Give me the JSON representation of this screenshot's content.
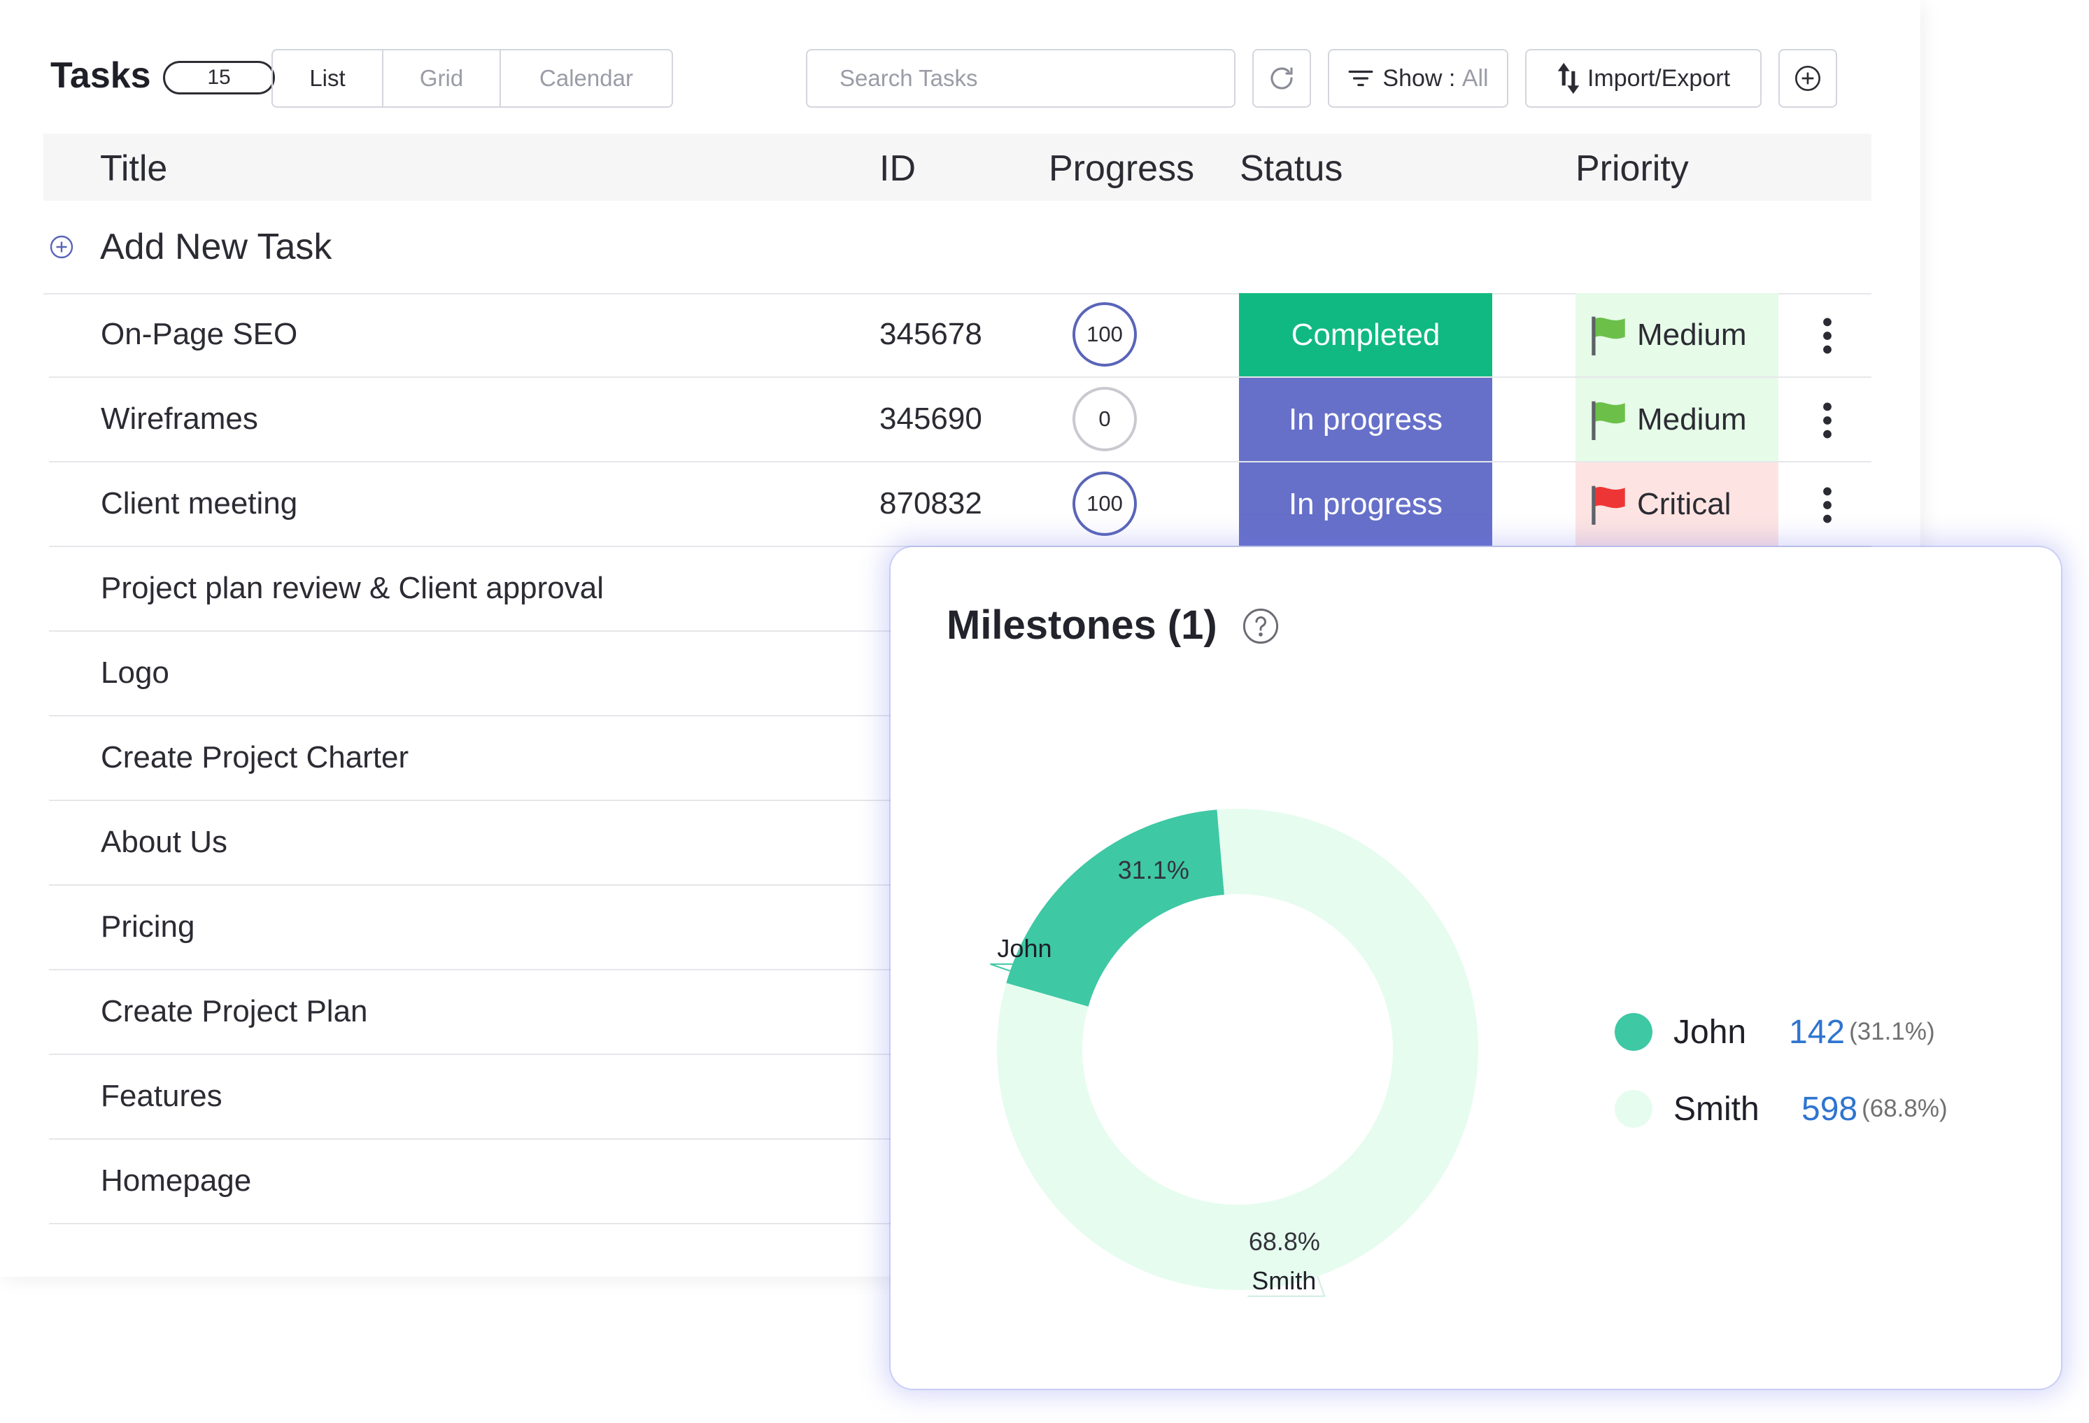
{
  "header": {
    "title": "Tasks",
    "count": "15",
    "views": [
      "List",
      "Grid",
      "Calendar"
    ],
    "active_view": "List",
    "search_placeholder": "Search Tasks",
    "show_label": "Show : ",
    "show_value": "All",
    "import_export_label": "Import/Export"
  },
  "table": {
    "columns": {
      "title": "Title",
      "id": "ID",
      "progress": "Progress",
      "status": "Status",
      "priority": "Priority"
    },
    "add_task_label": "Add New Task",
    "rows": [
      {
        "title": "On-Page SEO",
        "id": "345678",
        "progress": "100",
        "status": "Completed",
        "priority": "Medium"
      },
      {
        "title": "Wireframes",
        "id": "345690",
        "progress": "0",
        "status": "In progress",
        "priority": "Medium"
      },
      {
        "title": "Client meeting",
        "id": "870832",
        "progress": "100",
        "status": "In progress",
        "priority": "Critical"
      },
      {
        "title": "Project plan review & Client approval"
      },
      {
        "title": "Logo"
      },
      {
        "title": "Create Project Charter"
      },
      {
        "title": "About Us"
      },
      {
        "title": "Pricing"
      },
      {
        "title": "Create Project Plan"
      },
      {
        "title": "Features"
      },
      {
        "title": "Homepage"
      }
    ]
  },
  "colors": {
    "completed": "#10b981",
    "in_progress": "#6670c9",
    "medium_bg": "#e6fbe8",
    "medium_flag": "#6cc04a",
    "critical_bg": "#fde4e2",
    "critical_flag": "#ee3535",
    "john": "#3ec8a4",
    "smith": "#e6fcef",
    "legend_value": "#2f74d0"
  },
  "milestones": {
    "title": "Milestones (1)",
    "chart_data": {
      "type": "pie",
      "donut": true,
      "categories": [
        "John",
        "Smith"
      ],
      "values": [
        142,
        598
      ],
      "percent_labels": [
        "31.1%",
        "68.8%"
      ],
      "legend": [
        {
          "name": "John",
          "value": "142",
          "pct": "(31.1%)"
        },
        {
          "name": "Smith",
          "value": "598",
          "pct": "(68.8%)"
        }
      ],
      "legend_position": "right"
    }
  }
}
